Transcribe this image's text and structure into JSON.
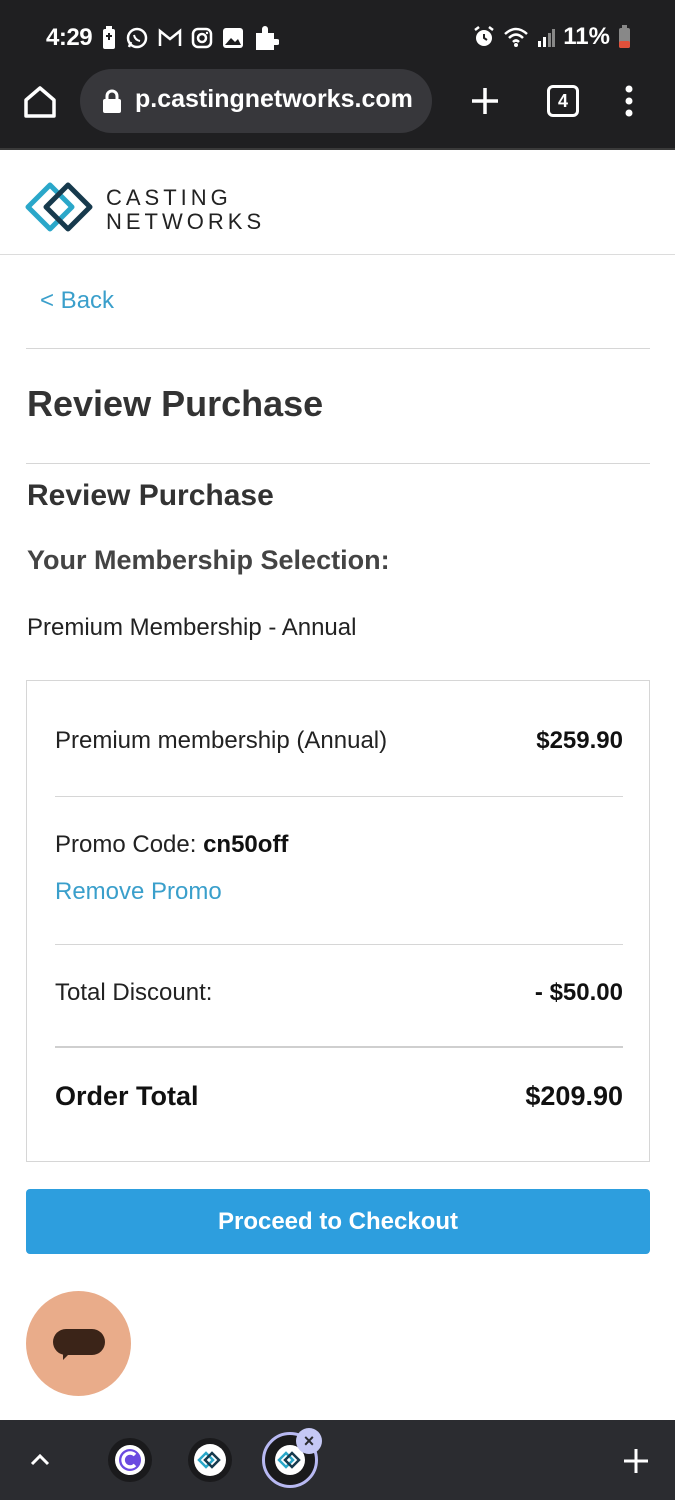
{
  "status_bar": {
    "time": "4:29",
    "battery_percent": "11%",
    "left_icons": [
      "battery-saver-icon",
      "whatsapp-icon",
      "gmail-icon",
      "instagram-icon",
      "gallery-icon",
      "puzzle-icon"
    ],
    "right_icons": [
      "alarm-icon",
      "wifi-icon",
      "signal-icon",
      "battery-low-icon"
    ]
  },
  "browser": {
    "url": "p.castingnetworks.com",
    "tab_count": "4"
  },
  "site": {
    "logo_line1": "CASTING",
    "logo_line2": "NETWORKS",
    "brand_color": "#1d6b8a"
  },
  "page": {
    "back_label": "< Back",
    "title": "Review Purchase",
    "section_title": "Review Purchase",
    "selection_label": "Your Membership Selection:",
    "selection_value": "Premium Membership - Annual"
  },
  "summary": {
    "item_label": "Premium membership (Annual)",
    "item_price": "$259.90",
    "promo_label": "Promo Code:",
    "promo_code": "cn50off",
    "remove_promo_label": "Remove Promo",
    "discount_label": "Total Discount:",
    "discount_value": "- $50.00",
    "total_label": "Order Total",
    "total_value": "$209.90"
  },
  "actions": {
    "checkout_label": "Proceed to Checkout",
    "accent_color": "#2d9ede"
  },
  "chat_widget": {
    "icon": "chat-icon",
    "color": "#e9ac8a"
  },
  "bottom_bar": {
    "close_label": "×"
  }
}
